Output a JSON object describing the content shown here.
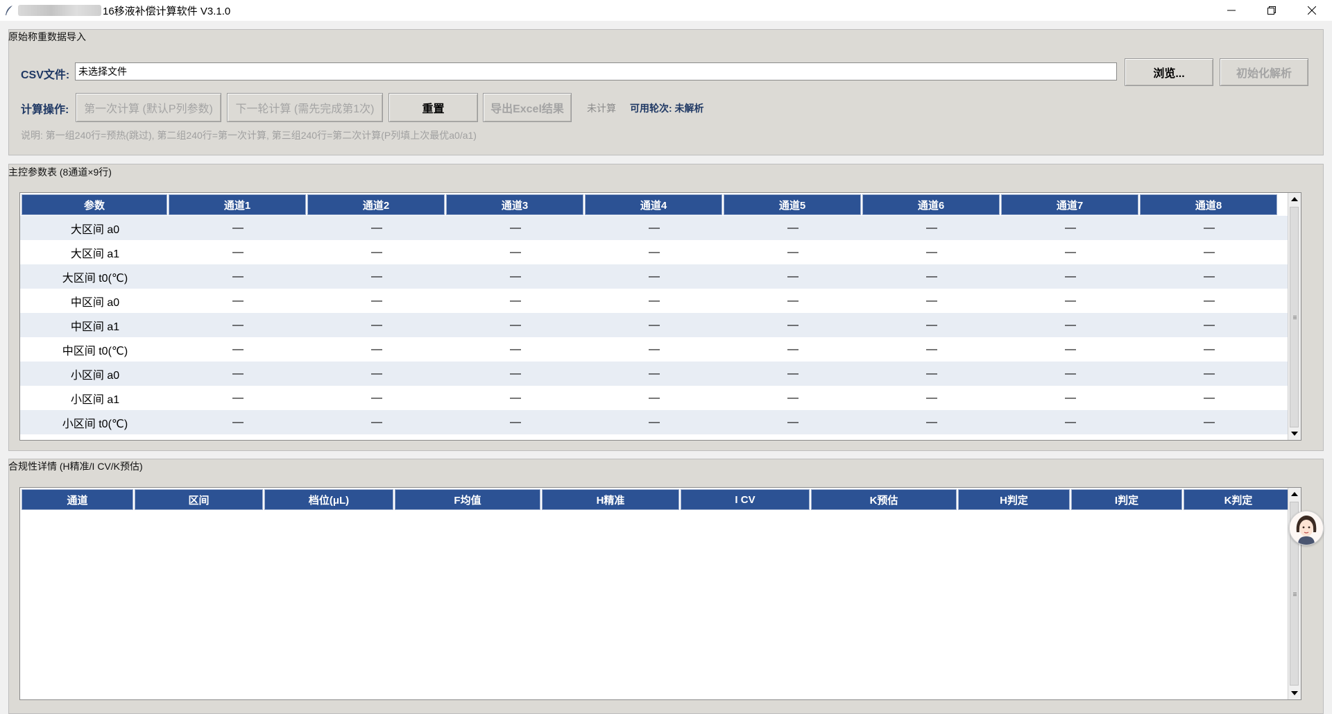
{
  "window": {
    "title": "16移液补偿计算软件 V3.1.0"
  },
  "import_section": {
    "title": "原始称重数据导入",
    "csv_label": "CSV文件:",
    "csv_value": "未选择文件",
    "browse_button": "浏览...",
    "init_parse_button": "初始化解析",
    "op_label": "计算操作:",
    "first_calc_button": "第一次计算 (默认P列参数)",
    "next_calc_button": "下一轮计算 (需先完成第1次)",
    "reset_button": "重置",
    "export_button": "导出Excel结果",
    "status": "未计算",
    "rounds": "可用轮次: 未解析",
    "note": "说明: 第一组240行=预热(跳过), 第二组240行=第一次计算, 第三组240行=第二次计算(P列填上次最优a0/a1)"
  },
  "param_section": {
    "title": "主控参数表 (8通道×9行)",
    "columns": [
      "参数",
      "通道1",
      "通道2",
      "通道3",
      "通道4",
      "通道5",
      "通道6",
      "通道7",
      "通道8"
    ],
    "rows": [
      {
        "label": "大区间 a0",
        "values": [
          "—",
          "—",
          "—",
          "—",
          "—",
          "—",
          "—",
          "—"
        ]
      },
      {
        "label": "大区间 a1",
        "values": [
          "—",
          "—",
          "—",
          "—",
          "—",
          "—",
          "—",
          "—"
        ]
      },
      {
        "label": "大区间 t0(℃)",
        "values": [
          "—",
          "—",
          "—",
          "—",
          "—",
          "—",
          "—",
          "—"
        ]
      },
      {
        "label": "中区间 a0",
        "values": [
          "—",
          "—",
          "—",
          "—",
          "—",
          "—",
          "—",
          "—"
        ]
      },
      {
        "label": "中区间 a1",
        "values": [
          "—",
          "—",
          "—",
          "—",
          "—",
          "—",
          "—",
          "—"
        ]
      },
      {
        "label": "中区间 t0(℃)",
        "values": [
          "—",
          "—",
          "—",
          "—",
          "—",
          "—",
          "—",
          "—"
        ]
      },
      {
        "label": "小区间 a0",
        "values": [
          "—",
          "—",
          "—",
          "—",
          "—",
          "—",
          "—",
          "—"
        ]
      },
      {
        "label": "小区间 a1",
        "values": [
          "—",
          "—",
          "—",
          "—",
          "—",
          "—",
          "—",
          "—"
        ]
      },
      {
        "label": "小区间 t0(℃)",
        "values": [
          "—",
          "—",
          "—",
          "—",
          "—",
          "—",
          "—",
          "—"
        ]
      }
    ]
  },
  "compliance_section": {
    "title": "合规性详情 (H精准/I CV/K预估)",
    "columns": [
      "通道",
      "区间",
      "档位(μL)",
      "F均值",
      "H精准",
      "I CV",
      "K预估",
      "H判定",
      "I判定",
      "K判定"
    ]
  },
  "colors": {
    "header_bg": "#2c5294",
    "label_blue": "#1f3864",
    "row_alt": "#e8edf4"
  }
}
